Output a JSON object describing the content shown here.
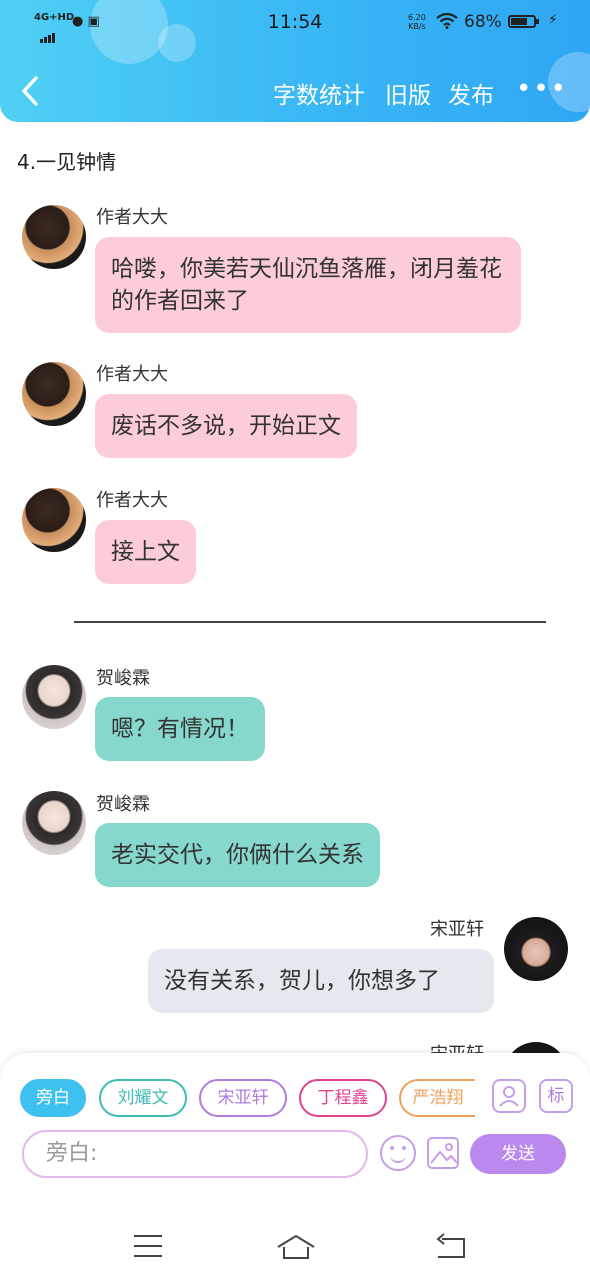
{
  "status_bar": {
    "network": "4G+HD",
    "time": "11:54",
    "speed_value": "6.20",
    "speed_unit": "KB/s",
    "battery": "68%"
  },
  "nav": {
    "back_icon": "chevron-left-icon",
    "word_count": "字数统计",
    "old_version": "旧版",
    "publish": "发布",
    "more_icon": "more-dots-icon"
  },
  "chapter_title": "4.一见钟情",
  "messages": [
    {
      "sender": "作者大大",
      "text": "哈喽，你美若天仙沉鱼落雁，闭月羞花的作者回来了",
      "side": "left",
      "color": "#fccdd8"
    },
    {
      "sender": "作者大大",
      "text": "废话不多说，开始正文",
      "side": "left",
      "color": "#fccdd8"
    },
    {
      "sender": "作者大大",
      "text": "接上文",
      "side": "left",
      "color": "#fccdd8"
    },
    {
      "sender": "贺峻霖",
      "text": "嗯？有情况！",
      "side": "left",
      "color": "#86d7cc"
    },
    {
      "sender": "贺峻霖",
      "text": "老实交代，你俩什么关系",
      "side": "left",
      "color": "#86d7cc"
    },
    {
      "sender": "宋亚轩",
      "text": "没有关系，贺儿，你想多了",
      "side": "right",
      "color": "#e5e9ef"
    },
    {
      "sender": "宋亚轩",
      "text": "",
      "side": "right",
      "color": ""
    }
  ],
  "composer": {
    "roles": [
      {
        "label": "旁白",
        "color": "#3fc1f0",
        "active": true
      },
      {
        "label": "刘耀文",
        "color": "#3dbcb3"
      },
      {
        "label": "宋亚轩",
        "color": "#b07ce0"
      },
      {
        "label": "丁程鑫",
        "color": "#e0448f"
      },
      {
        "label": "严浩翔",
        "color": "#f0a05a"
      }
    ],
    "tag_label": "标",
    "input_placeholder": "旁白:",
    "send_label": "发送"
  }
}
